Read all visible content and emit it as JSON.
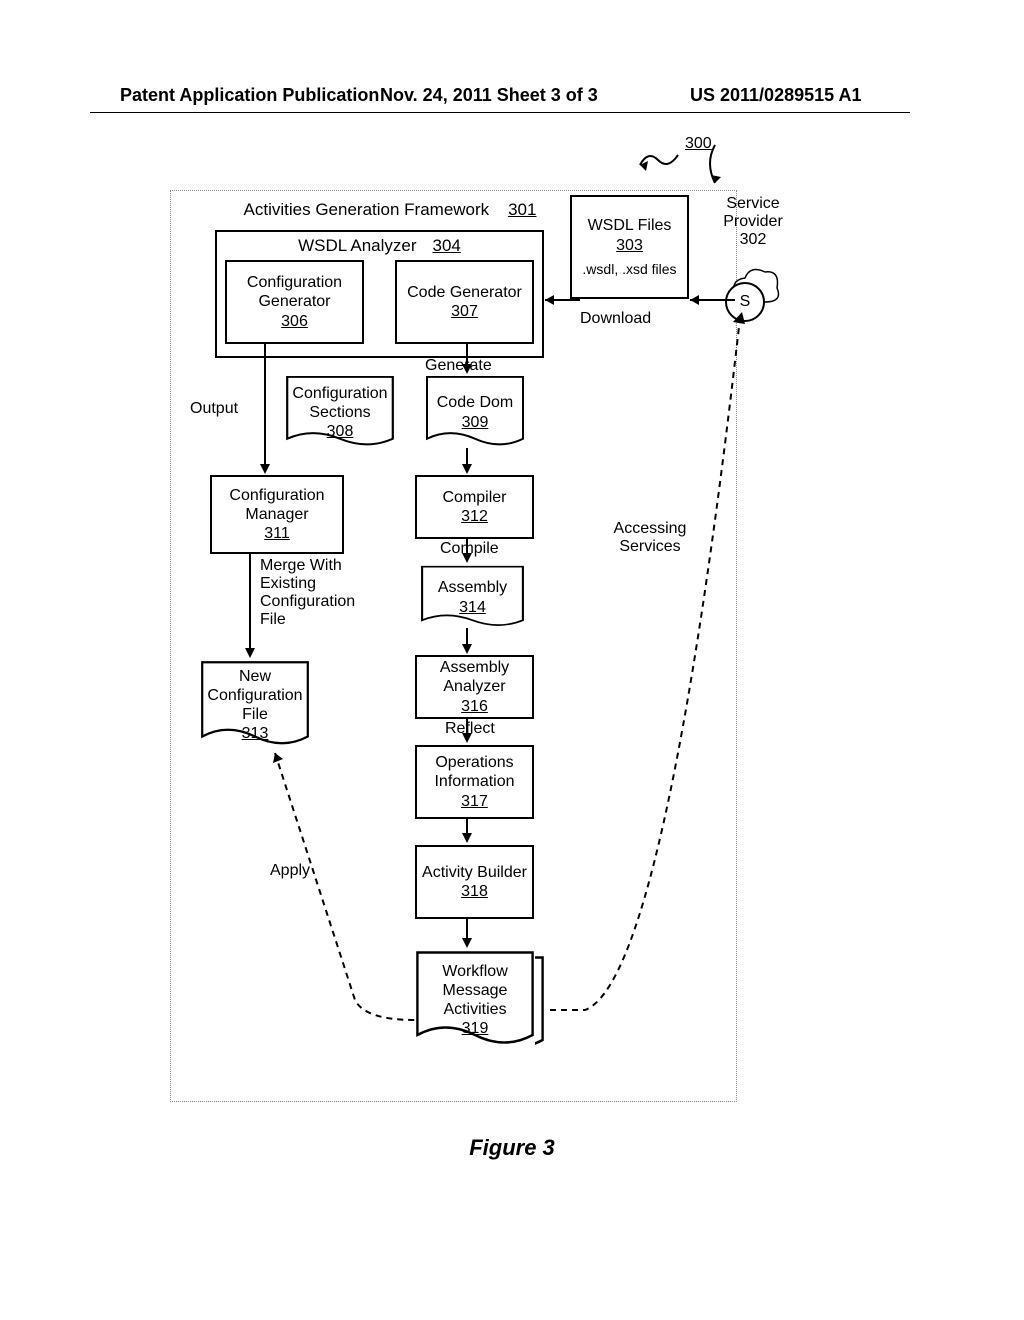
{
  "header": {
    "left": "Patent Application Publication",
    "mid": "Nov. 24, 2011  Sheet 3 of 3",
    "right": "US 2011/0289515 A1"
  },
  "figure_caption": "Figure 3",
  "top_refs": {
    "overall": "300"
  },
  "frame": {
    "title": "Activities Generation Framework",
    "ref": "301"
  },
  "wsdl_files": {
    "title": "WSDL Files",
    "ref": "303",
    "files": ".wsdl, .xsd files"
  },
  "service_provider": {
    "title": "Service Provider",
    "ref": "302",
    "icon": "S"
  },
  "wsdl_analyzer": {
    "title": "WSDL Analyzer",
    "ref": "304"
  },
  "cfg_gen": {
    "title": "Configuration Generator",
    "ref": "306"
  },
  "code_gen": {
    "title": "Code Generator",
    "ref": "307"
  },
  "generate_lbl": "Generate",
  "output_lbl": "Output",
  "cfg_sections": {
    "title": "Configuration Sections",
    "ref": "308"
  },
  "code_dom": {
    "title": "Code Dom",
    "ref": "309"
  },
  "cfg_mgr": {
    "title": "Configuration Manager",
    "ref": "311"
  },
  "compiler": {
    "title": "Compiler",
    "ref": "312"
  },
  "compile_lbl": "Compile",
  "merge_lbl": "Merge With Existing Configuration File",
  "new_cfg": {
    "title": "New Configuration File",
    "ref": "313"
  },
  "assembly": {
    "title": "Assembly",
    "ref": "314"
  },
  "asm_analyzer": {
    "title": "Assembly Analyzer",
    "ref": "316"
  },
  "reflect_lbl": "Reflect",
  "ops_info": {
    "title": "Operations Information",
    "ref": "317"
  },
  "activity_builder": {
    "title": "Activity Builder",
    "ref": "318"
  },
  "wf_activities": {
    "title": "Workflow Message Activities",
    "ref": "319"
  },
  "download_lbl": "Download",
  "accessing_lbl": "Accessing Services",
  "apply_lbl": "Apply"
}
